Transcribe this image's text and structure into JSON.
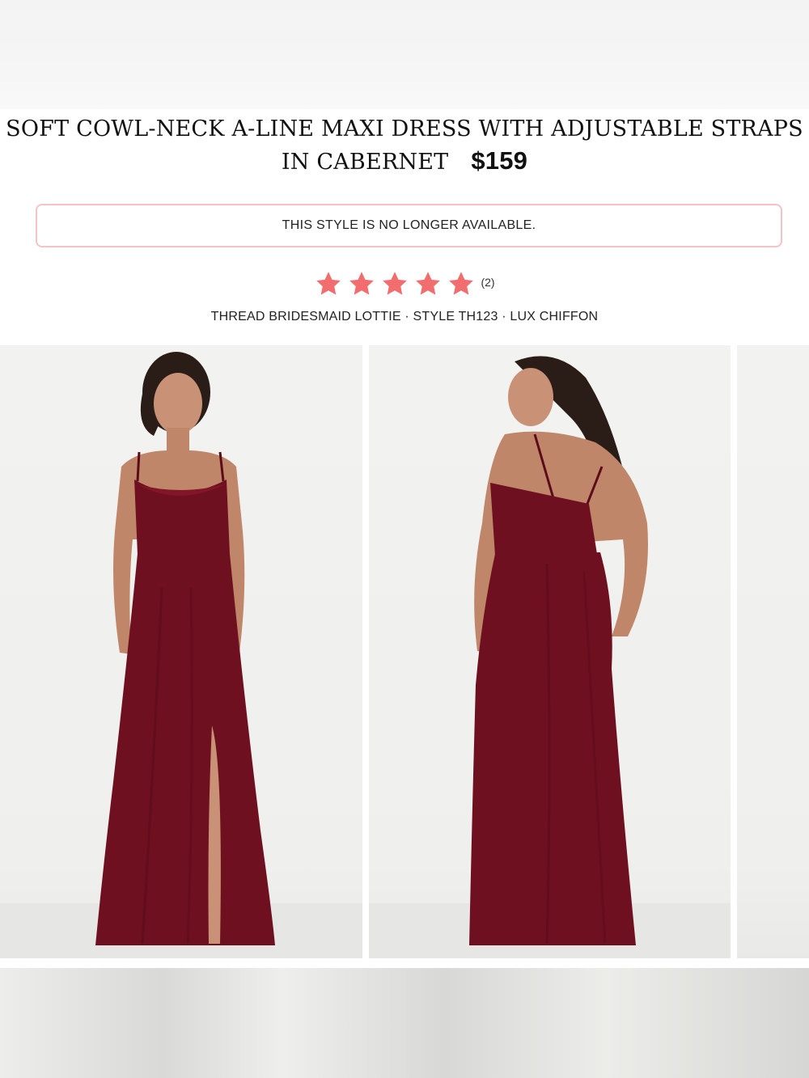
{
  "product": {
    "title_line1": "SOFT COWL-NECK A-LINE MAXI DRESS WITH ADJUSTABLE STRAPS",
    "title_line2": "IN CABERNET",
    "price": "$159"
  },
  "availability_notice": "THIS STYLE IS NO LONGER AVAILABLE.",
  "rating": {
    "stars": 5,
    "max_stars": 5,
    "review_count": "(2)",
    "star_color": "#f26d6d"
  },
  "meta_line": "THREAD BRIDESMAID LOTTIE · STYLE TH123 · LUX CHIFFON",
  "colors": {
    "dress": "#6e1020",
    "notice_border": "#f3c4c7"
  },
  "gallery": {
    "images": [
      "front-view-photo",
      "back-view-photo",
      "next-photo-partial"
    ]
  }
}
